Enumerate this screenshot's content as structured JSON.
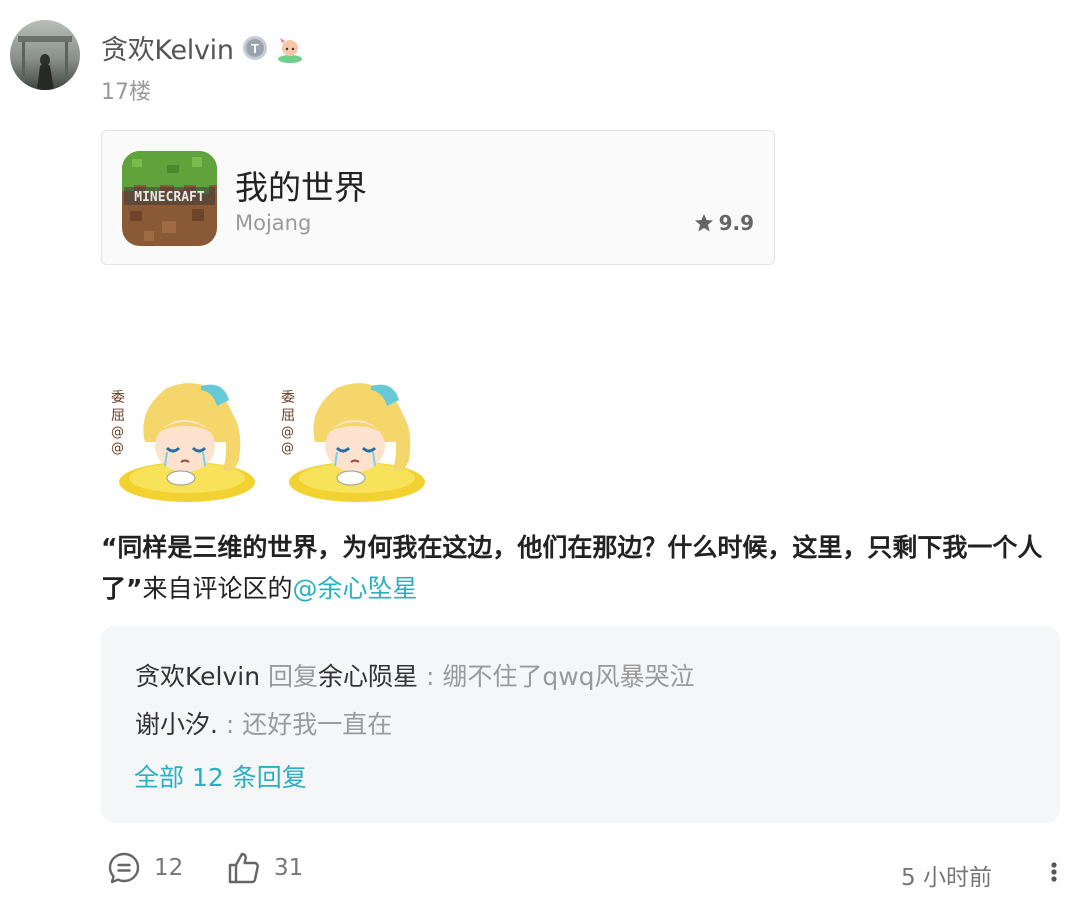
{
  "author": {
    "name": "贪欢Kelvin",
    "floor": "17楼"
  },
  "app_card": {
    "icon_text": "MINECRAFT",
    "title": "我的世界",
    "developer": "Mojang",
    "rating": "9.9"
  },
  "content": {
    "quote": "“同样是三维的世界，为何我在这边，他们在那边？什么时候，这里，只剩下我一个人了”",
    "suffix": "来自评论区的",
    "mention": "@余心坠星"
  },
  "replies": {
    "items": [
      {
        "author": "贪欢Kelvin",
        "action": " 回复",
        "target": "余心陨星",
        "sep": " : ",
        "text": "绷不住了qwq风暴哭泣"
      },
      {
        "author": "谢小汐.",
        "action": "",
        "target": "",
        "sep": " : ",
        "text": "还好我一直在"
      }
    ],
    "all_label": "全部 12 条回复"
  },
  "actions": {
    "comment_count": "12",
    "like_count": "31",
    "time": "5 小时前"
  },
  "colors": {
    "accent": "#2ab0c5",
    "muted": "#9a9a9a"
  }
}
